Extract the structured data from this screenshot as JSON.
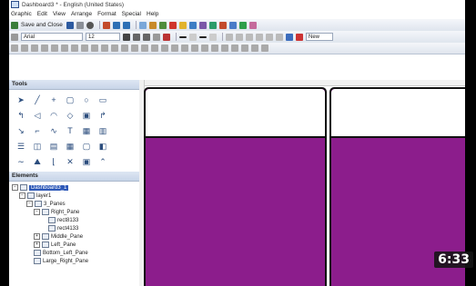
{
  "window": {
    "title": "Dashboard3 * - English (United States)"
  },
  "menu": [
    "Graphic",
    "Edit",
    "View",
    "Arrange",
    "Format",
    "Special",
    "Help"
  ],
  "toolbar": {
    "save_close_label": "Save and Close"
  },
  "format_bar": {
    "font": "Arial",
    "size": "12",
    "new_label": "New"
  },
  "panels": {
    "tools_title": "Tools",
    "elements_title": "Elements"
  },
  "tree": {
    "dashboard": "Dashboard3_1",
    "layer": "layer1",
    "panes": "3_Panes",
    "right_pane": "Right_Pane",
    "rect1": "rect8133",
    "rect2": "rect4133",
    "middle_pane": "Middle_Pane",
    "left_pane": "Left_Pane",
    "bottom_left": "Bottom_Left_Pane",
    "large_right": "Large_Right_Pane"
  },
  "video": {
    "duration": "6:33"
  },
  "colors": {
    "pane_fill": "#8c1d8c",
    "pane_border": "#111111",
    "selection": "#2e59b8"
  }
}
